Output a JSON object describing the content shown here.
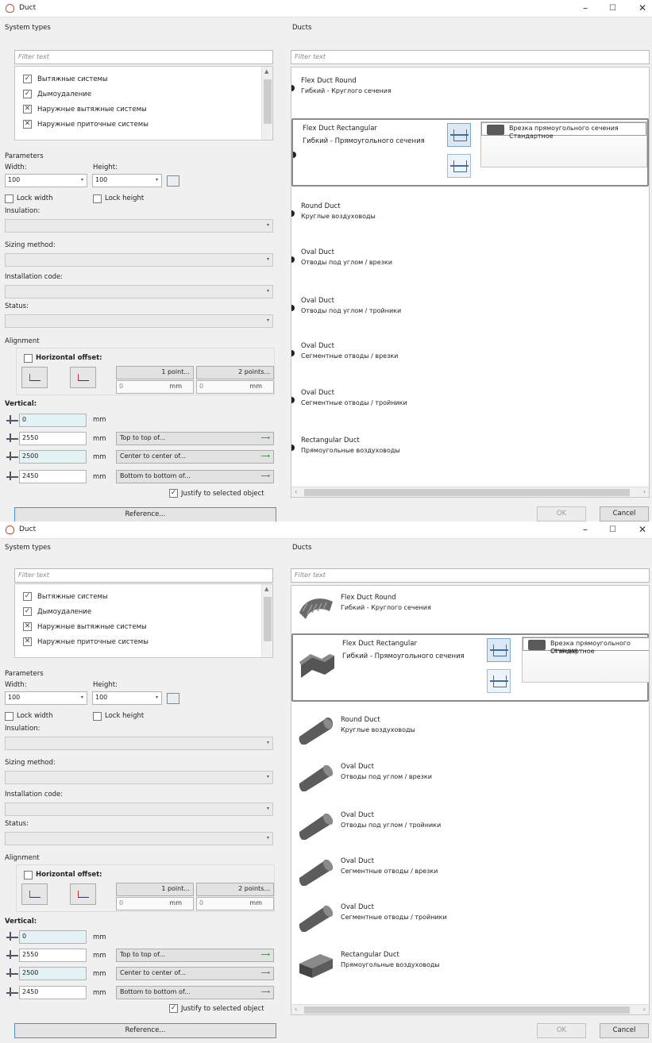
{
  "window": {
    "title": "Duct",
    "minimize": "–",
    "maximize": "☐",
    "close": "✕"
  },
  "system_types": {
    "label": "System types",
    "filter_placeholder": "Filter text",
    "items": [
      {
        "label": "Вытяжные системы",
        "state": "check"
      },
      {
        "label": "Дымоудаление",
        "state": "check"
      },
      {
        "label": "Наружные вытяжные системы",
        "state": "cross"
      },
      {
        "label": "Наружные приточные системы",
        "state": "cross"
      }
    ]
  },
  "parameters": {
    "label": "Parameters",
    "width_label": "Width:",
    "width_value": "100",
    "height_label": "Height:",
    "height_value": "100",
    "lock_width": "Lock width",
    "lock_height": "Lock height",
    "insulation_label": "Insulation:",
    "sizing_label": "Sizing method:",
    "installation_label": "Installation code:",
    "status_label": "Status:"
  },
  "alignment": {
    "label": "Alignment",
    "horizontal_offset": "Horizontal offset:",
    "one_point": "1 point...",
    "two_points": "2 points...",
    "offset1_value": "0",
    "offset2_value": "0",
    "unit": "mm",
    "vertical": "Vertical:",
    "rows": [
      {
        "value": "0",
        "button": ""
      },
      {
        "value": "2550",
        "button": "Top to top of..."
      },
      {
        "value": "2500",
        "button": "Center to center of..."
      },
      {
        "value": "2450",
        "button": "Bottom to bottom of..."
      }
    ],
    "justify": "Justify to selected object"
  },
  "reference_button": "Reference...",
  "ducts": {
    "label": "Ducts",
    "filter_placeholder": "Filter text",
    "items": [
      {
        "name": "Flex Duct Round",
        "desc": "Гибкий - Круглого сечения",
        "icon": "flex-round"
      },
      {
        "name": "Flex Duct Rectangular",
        "desc": "Гибкий - Прямоугольного сечения",
        "icon": "flex-rect"
      },
      {
        "name": "Round Duct",
        "desc": "Круглые воздуховоды",
        "icon": "round"
      },
      {
        "name": "Oval Duct",
        "desc": "Отводы под углом / врезки",
        "icon": "oval"
      },
      {
        "name": "Oval Duct",
        "desc": "Отводы под углом / тройники",
        "icon": "oval"
      },
      {
        "name": "Oval Duct",
        "desc": "Сегментные отводы / врезки",
        "icon": "oval"
      },
      {
        "name": "Oval Duct",
        "desc": "Сегментные отводы / тройники",
        "icon": "oval"
      },
      {
        "name": "Rectangular Duct",
        "desc": "Прямоугольные воздуховоды",
        "icon": "rect"
      }
    ],
    "fitting_name": "Врезка прямоугольного сечения",
    "fitting_type": "Стандартное"
  },
  "ok_button": "OK",
  "cancel_button": "Cancel"
}
